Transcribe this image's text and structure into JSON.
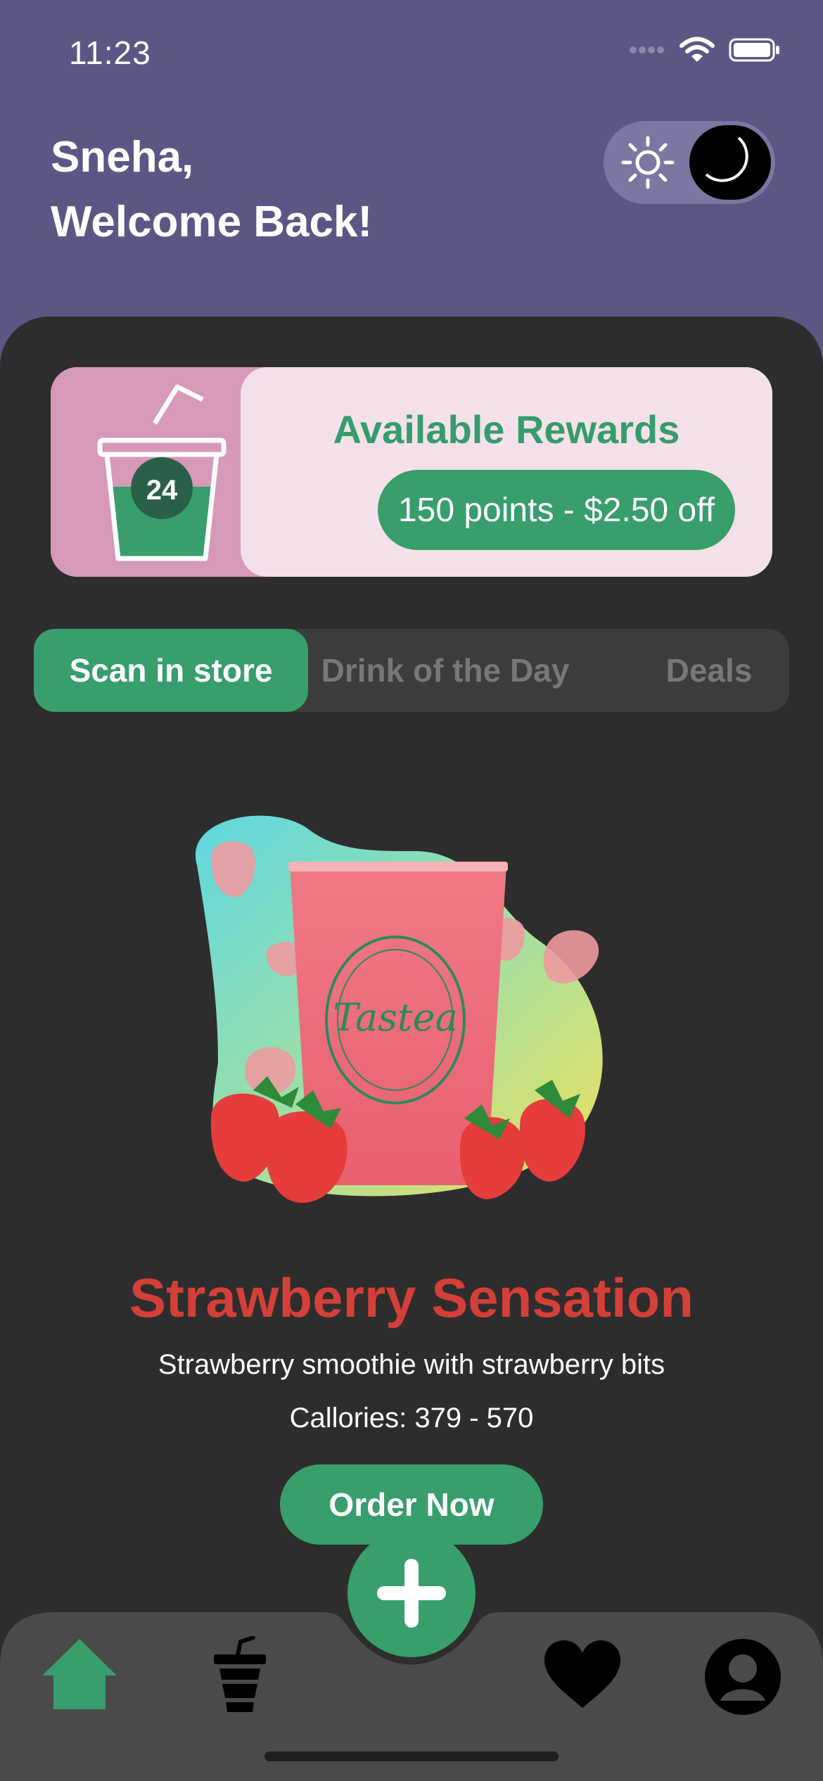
{
  "status_bar": {
    "time": "11:23"
  },
  "header": {
    "greeting_line1": "Sneha,",
    "greeting_line2": "Welcome Back!"
  },
  "rewards": {
    "count": "24",
    "title": "Available Rewards",
    "offer": "150 points - $2.50 off"
  },
  "tabs": [
    {
      "label": "Scan in store",
      "active": true
    },
    {
      "label": "Drink of the Day",
      "active": false
    },
    {
      "label": "Deals",
      "active": false
    }
  ],
  "featured": {
    "name": "Strawberry Sensation",
    "description": "Strawberry smoothie with strawberry bits",
    "calories": "Callories: 379 - 570",
    "order_label": "Order Now",
    "cup_logo": "Tastea"
  },
  "tab_bar": {
    "items": [
      {
        "icon": "home-icon",
        "active": true
      },
      {
        "icon": "drink-cup-icon",
        "active": false
      },
      {
        "icon": "plus-icon",
        "active": false
      },
      {
        "icon": "heart-icon",
        "active": false
      },
      {
        "icon": "profile-icon",
        "active": false
      }
    ]
  },
  "colors": {
    "header_bg": "#5b5785",
    "panel_bg": "#2d2d2d",
    "accent_green": "#379e6c",
    "drink_title_red": "#d43f37",
    "reward_pink": "#d699b8",
    "reward_light": "#f4e1e9"
  }
}
